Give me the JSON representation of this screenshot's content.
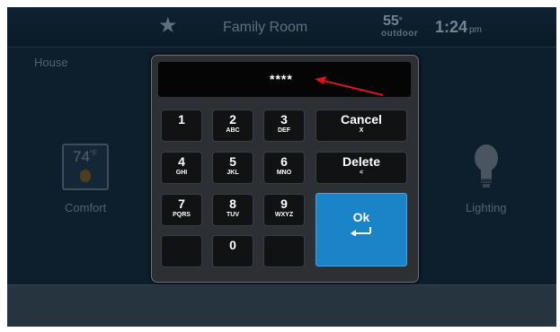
{
  "status_bar": {
    "room": "Family Room",
    "temperature": "55",
    "degree": "°",
    "outdoor_label": "outdoor",
    "time": "1:24",
    "ampm": "pm"
  },
  "background": {
    "house_label": "House",
    "thermostat_temp": "74",
    "thermostat_unit": "°F",
    "comfort_label": "Comfort",
    "lighting_label": "Lighting"
  },
  "keypad": {
    "entered_code": "****",
    "keys": [
      {
        "num": "1",
        "sub": ""
      },
      {
        "num": "2",
        "sub": "ABC"
      },
      {
        "num": "3",
        "sub": "DEF"
      },
      {
        "num": "4",
        "sub": "GHI"
      },
      {
        "num": "5",
        "sub": "JKL"
      },
      {
        "num": "6",
        "sub": "MNO"
      },
      {
        "num": "7",
        "sub": "PQRS"
      },
      {
        "num": "8",
        "sub": "TUV"
      },
      {
        "num": "9",
        "sub": "WXYZ"
      },
      {
        "num": "",
        "sub": ""
      },
      {
        "num": "0",
        "sub": ""
      },
      {
        "num": "",
        "sub": ""
      }
    ],
    "cancel": {
      "label": "Cancel",
      "sub": "X"
    },
    "delete": {
      "label": "Delete",
      "sub": "<"
    },
    "ok": {
      "label": "Ok"
    }
  },
  "colors": {
    "accent": "#1b83c8",
    "annotation_arrow": "#d0191f"
  }
}
